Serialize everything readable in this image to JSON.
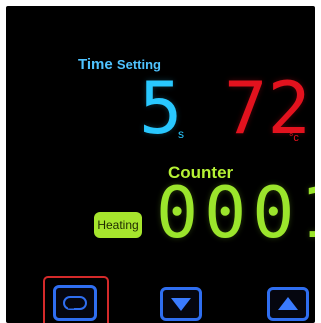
{
  "display": {
    "time_setting": {
      "label_main": "Time",
      "label_sub": "Setting",
      "value": "5",
      "unit": "s"
    },
    "temperature": {
      "value": "72",
      "unit": "°c"
    },
    "counter": {
      "label": "Counter",
      "value": "0001"
    },
    "status_badge": {
      "label": "Heating"
    }
  },
  "keys": [
    {
      "name": "cycle",
      "icon": "cycle-icon"
    },
    {
      "name": "down",
      "icon": "triangle-down-icon"
    },
    {
      "name": "up",
      "icon": "triangle-up-icon"
    }
  ],
  "colors": {
    "time": "#29c8ff",
    "temperature": "#e3121e",
    "counter": "#9be52c",
    "badge": "#a6e52d",
    "key_border": "#2f6ef0",
    "selected_key_frame": "#d42a2a",
    "panel_background": "#000000"
  }
}
